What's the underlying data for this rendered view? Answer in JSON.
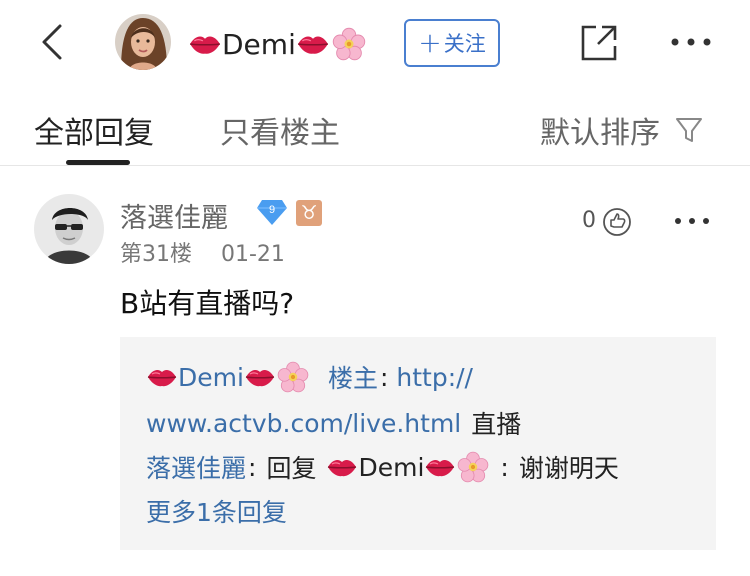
{
  "header": {
    "title_name": "Demi",
    "follow_label": "关注",
    "icons": [
      "back-icon",
      "lips-icon",
      "cherry-blossom-icon",
      "share-icon",
      "more-icon"
    ]
  },
  "tabs": {
    "all_label": "全部回复",
    "owner_only_label": "只看楼主",
    "sort_label": "默认排序"
  },
  "post": {
    "username": "落選佳麗",
    "level": "9",
    "zodiac": "♉",
    "floor": "第31楼",
    "date": "01-21",
    "like_count": "0",
    "content": "B站有直播吗?"
  },
  "reply_box": {
    "reply1": {
      "author": "Demi",
      "author_tag": "楼主",
      "colon": ":",
      "link_part1": "http://",
      "link_part2": "www.actvb.com/live.html",
      "text_after": "直播"
    },
    "reply2": {
      "author": "落選佳麗",
      "colon": ":",
      "reply_word": "回复",
      "target": "Demi",
      "colon2": ":",
      "text": "谢谢明天"
    },
    "more_label": "更多1条回复"
  },
  "colors": {
    "accent_blue": "#3b6ea9",
    "follow_blue": "#4a7fd0",
    "reply_bg": "#f4f4f4"
  }
}
